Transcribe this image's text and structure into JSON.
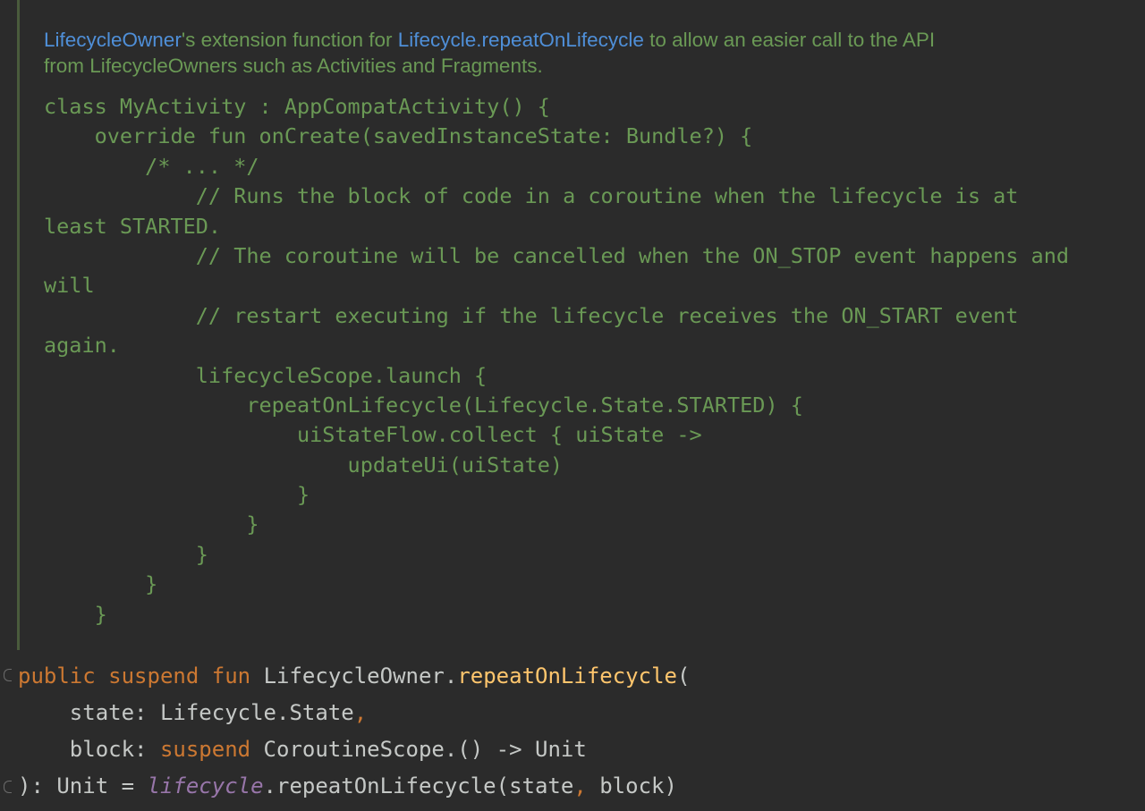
{
  "doc": {
    "summary": {
      "link1": "LifecycleOwner",
      "text1": "'s extension function for ",
      "link2": "Lifecycle.repeatOnLifecycle",
      "text2": " to allow an easier call to the API",
      "line2": "from LifecycleOwners such as Activities and Fragments."
    },
    "code_lines": [
      "class MyActivity : AppCompatActivity() {",
      "    override fun onCreate(savedInstanceState: Bundle?) {",
      "        /* ... */",
      "            // Runs the block of code in a coroutine when the lifecycle is at",
      "least STARTED.",
      "            // The coroutine will be cancelled when the ON_STOP event happens and",
      "will",
      "            // restart executing if the lifecycle receives the ON_START event",
      "again.",
      "            lifecycleScope.launch {",
      "                repeatOnLifecycle(Lifecycle.State.STARTED) {",
      "                    uiStateFlow.collect { uiState ->",
      "                        updateUi(uiState)",
      "                    }",
      "                }",
      "            }",
      "        }",
      "    }"
    ]
  },
  "signature": {
    "kw_public": "public",
    "kw_suspend": "suspend",
    "kw_fun": "fun",
    "receiver": "LifecycleOwner.",
    "name": "repeatOnLifecycle",
    "open_paren": "(",
    "param1_name": "state: ",
    "param1_type": "Lifecycle.State",
    "comma": ",",
    "param2_name": "block: ",
    "param2_kw": "suspend",
    "param2_type": " CoroutineScope.() -> Unit",
    "ret": "): Unit = ",
    "prop": "lifecycle",
    "call": ".repeatOnLifecycle(state",
    "call_comma": ",",
    "call_end": " block)"
  },
  "colors": {
    "background": "#2b2b2b",
    "doc_text": "#6a9955",
    "doc_link": "#4f8fd8",
    "keyword": "#cc7832",
    "function": "#ffc66d",
    "property": "#9876aa",
    "default_text": "#c5c8c6"
  }
}
